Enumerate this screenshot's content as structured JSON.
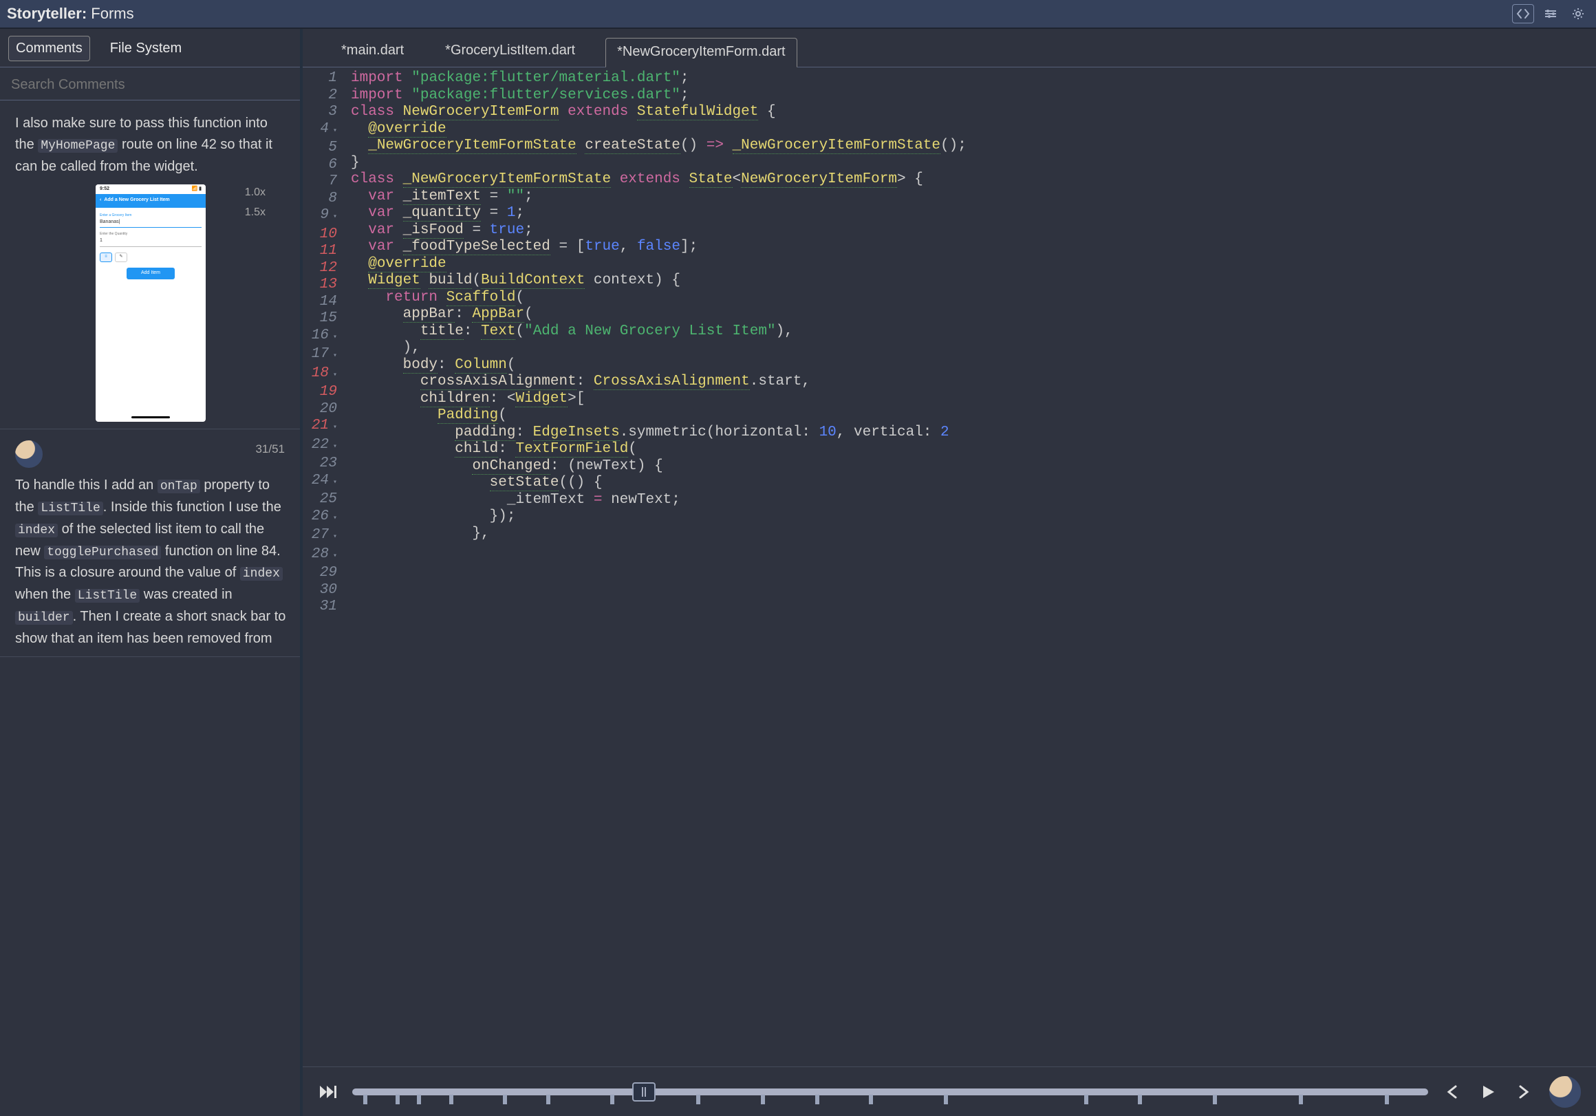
{
  "app": {
    "title_prefix": "Storyteller:",
    "title_name": "Forms"
  },
  "titlebar_icons": [
    "code-icon",
    "controls-icon",
    "gear-icon"
  ],
  "left": {
    "tabs": [
      "Comments",
      "File System"
    ],
    "active_tab": 0,
    "search_placeholder": "Search Comments",
    "comment1": {
      "pre": "I also make sure to pass this function into the ",
      "code1": "MyHomePage",
      "post1": " route on line 42 so that it can be called from the widget.",
      "zoom": [
        "1.0x",
        "1.5x"
      ],
      "phone": {
        "time": "9:52",
        "header": "Add a New Grocery List Item",
        "label1": "Enter a Grocery Item",
        "val1": "Bananas|",
        "label2": "Enter the Quantity",
        "val2": "1",
        "toggle": [
          "≡",
          "✎"
        ],
        "add_btn": "Add Item"
      }
    },
    "comment2": {
      "counter": "31/51",
      "p1_a": "To handle this I add an ",
      "p1_code1": "onTap",
      "p1_b": " property to the ",
      "p1_code2": "ListTile",
      "p1_c": ". Inside this function I use the ",
      "p1_code3": "index",
      "p1_d": " of the selected list item to call the new ",
      "p1_code4": "togglePurchased",
      "p1_e": " function on line 84. This is a closure around the value of ",
      "p1_code5": "index",
      "p1_f": " when the ",
      "p1_code6": "ListTile",
      "p1_g": " was created in ",
      "p1_code7": "builder",
      "p1_h": ". Then I create a short snack bar to show that an item has been removed from"
    }
  },
  "right": {
    "tabs": [
      "*main.dart",
      "*GroceryListItem.dart",
      "*NewGroceryItemForm.dart"
    ],
    "active_tab": 2,
    "gutter": {
      "lines": [
        1,
        2,
        3,
        4,
        5,
        6,
        7,
        8,
        9,
        10,
        11,
        12,
        13,
        14,
        15,
        16,
        17,
        18,
        19,
        20,
        21,
        22,
        23,
        24,
        25,
        26,
        27,
        28,
        29,
        30,
        31
      ],
      "highlighted": [
        10,
        11,
        12,
        13,
        18,
        19,
        21
      ],
      "fold_open": [
        4,
        9,
        16,
        17,
        18,
        21,
        22,
        24,
        26,
        27,
        28
      ]
    },
    "code_tokens": [
      [
        [
          "kw",
          "import"
        ],
        [
          "pl",
          " "
        ],
        [
          "str",
          "\"package:flutter/material.dart\""
        ],
        [
          "pl",
          ";"
        ]
      ],
      [
        [
          "kw",
          "import"
        ],
        [
          "pl",
          " "
        ],
        [
          "str",
          "\"package:flutter/services.dart\""
        ],
        [
          "pl",
          ";"
        ]
      ],
      [
        [
          "pl",
          ""
        ]
      ],
      [
        [
          "kw",
          "class"
        ],
        [
          "pl",
          " "
        ],
        [
          "cls",
          "NewGroceryItemForm"
        ],
        [
          "pl",
          " "
        ],
        [
          "kw",
          "extends"
        ],
        [
          "pl",
          " "
        ],
        [
          "typ",
          "StatefulWidget"
        ],
        [
          "pl",
          " {"
        ]
      ],
      [
        [
          "pl",
          "  "
        ],
        [
          "typ",
          "@override"
        ]
      ],
      [
        [
          "pl",
          "  "
        ],
        [
          "typ",
          "_NewGroceryItemFormState"
        ],
        [
          "pl",
          " "
        ],
        [
          "fn",
          "createState"
        ],
        [
          "pl",
          "() "
        ],
        [
          "op",
          "=>"
        ],
        [
          "pl",
          " "
        ],
        [
          "typ",
          "_NewGroceryItemFormState"
        ],
        [
          "pl",
          "();"
        ]
      ],
      [
        [
          "pl",
          "}"
        ]
      ],
      [
        [
          "pl",
          ""
        ]
      ],
      [
        [
          "kw",
          "class"
        ],
        [
          "pl",
          " "
        ],
        [
          "cls",
          "_NewGroceryItemFormState"
        ],
        [
          "pl",
          " "
        ],
        [
          "kw",
          "extends"
        ],
        [
          "pl",
          " "
        ],
        [
          "typ",
          "State"
        ],
        [
          "pl",
          "<"
        ],
        [
          "typ",
          "NewGroceryItemForm"
        ],
        [
          "pl",
          "> {"
        ]
      ],
      [
        [
          "pl",
          "  "
        ],
        [
          "kw",
          "var"
        ],
        [
          "pl",
          " "
        ],
        [
          "fn",
          "_itemText"
        ],
        [
          "pl",
          " = "
        ],
        [
          "str",
          "\"\""
        ],
        [
          "pl",
          ";"
        ]
      ],
      [
        [
          "pl",
          "  "
        ],
        [
          "kw",
          "var"
        ],
        [
          "pl",
          " "
        ],
        [
          "fn",
          "_quantity"
        ],
        [
          "pl",
          " = "
        ],
        [
          "num",
          "1"
        ],
        [
          "pl",
          ";"
        ]
      ],
      [
        [
          "pl",
          "  "
        ],
        [
          "kw",
          "var"
        ],
        [
          "pl",
          " "
        ],
        [
          "fn",
          "_isFood"
        ],
        [
          "pl",
          " = "
        ],
        [
          "bool",
          "true"
        ],
        [
          "pl",
          ";"
        ]
      ],
      [
        [
          "pl",
          "  "
        ],
        [
          "kw",
          "var"
        ],
        [
          "pl",
          " "
        ],
        [
          "fn",
          "_foodTypeSelected"
        ],
        [
          "pl",
          " = ["
        ],
        [
          "bool",
          "true"
        ],
        [
          "pl",
          ", "
        ],
        [
          "bool",
          "false"
        ],
        [
          "pl",
          "];"
        ]
      ],
      [
        [
          "pl",
          ""
        ]
      ],
      [
        [
          "pl",
          "  "
        ],
        [
          "typ",
          "@override"
        ]
      ],
      [
        [
          "pl",
          "  "
        ],
        [
          "typ",
          "Widget"
        ],
        [
          "pl",
          " "
        ],
        [
          "fn",
          "build"
        ],
        [
          "pl",
          "("
        ],
        [
          "typ",
          "BuildContext"
        ],
        [
          "pl",
          " context) {"
        ]
      ],
      [
        [
          "pl",
          "    "
        ],
        [
          "kw",
          "return"
        ],
        [
          "pl",
          " "
        ],
        [
          "typ",
          "Scaffold"
        ],
        [
          "pl",
          "("
        ]
      ],
      [
        [
          "pl",
          "      "
        ],
        [
          "fn",
          "appBar"
        ],
        [
          "pl",
          ": "
        ],
        [
          "typ",
          "AppBar"
        ],
        [
          "pl",
          "("
        ]
      ],
      [
        [
          "pl",
          "        "
        ],
        [
          "fn",
          "title"
        ],
        [
          "pl",
          ": "
        ],
        [
          "typ",
          "Text"
        ],
        [
          "pl",
          "("
        ],
        [
          "str",
          "\"Add a New Grocery List Item\""
        ],
        [
          "pl",
          "),"
        ]
      ],
      [
        [
          "pl",
          "      ),"
        ]
      ],
      [
        [
          "pl",
          "      "
        ],
        [
          "fn",
          "body"
        ],
        [
          "pl",
          ": "
        ],
        [
          "typ",
          "Column"
        ],
        [
          "pl",
          "("
        ]
      ],
      [
        [
          "pl",
          "        "
        ],
        [
          "fn",
          "crossAxisAlignment"
        ],
        [
          "pl",
          ": "
        ],
        [
          "typ",
          "CrossAxisAlignment"
        ],
        [
          "pl",
          ".start,"
        ]
      ],
      [
        [
          "pl",
          "        "
        ],
        [
          "fn",
          "children"
        ],
        [
          "pl",
          ": <"
        ],
        [
          "typ",
          "Widget"
        ],
        [
          "pl",
          ">["
        ]
      ],
      [
        [
          "pl",
          "          "
        ],
        [
          "typ",
          "Padding"
        ],
        [
          "pl",
          "("
        ]
      ],
      [
        [
          "pl",
          "            "
        ],
        [
          "fn",
          "padding"
        ],
        [
          "pl",
          ": "
        ],
        [
          "typ",
          "EdgeInsets"
        ],
        [
          "pl",
          ".symmetric(horizontal: "
        ],
        [
          "num",
          "10"
        ],
        [
          "pl",
          ", vertical: "
        ],
        [
          "num",
          "2"
        ]
      ],
      [
        [
          "pl",
          "            "
        ],
        [
          "fn",
          "child"
        ],
        [
          "pl",
          ": "
        ],
        [
          "typ",
          "TextFormField"
        ],
        [
          "pl",
          "("
        ]
      ],
      [
        [
          "pl",
          "              "
        ],
        [
          "fn",
          "onChanged"
        ],
        [
          "pl",
          ": (newText) {"
        ]
      ],
      [
        [
          "pl",
          "                "
        ],
        [
          "fn",
          "setState"
        ],
        [
          "pl",
          "(() {"
        ]
      ],
      [
        [
          "pl",
          "                  _itemText "
        ],
        [
          "op",
          "="
        ],
        [
          "pl",
          " newText;"
        ]
      ],
      [
        [
          "pl",
          "                });"
        ]
      ],
      [
        [
          "pl",
          "              },"
        ]
      ]
    ]
  },
  "playbar": {
    "tick_positions_pct": [
      1,
      4,
      6,
      9,
      14,
      18,
      24,
      32,
      38,
      43,
      48,
      55,
      68,
      73,
      80,
      88,
      96
    ]
  }
}
